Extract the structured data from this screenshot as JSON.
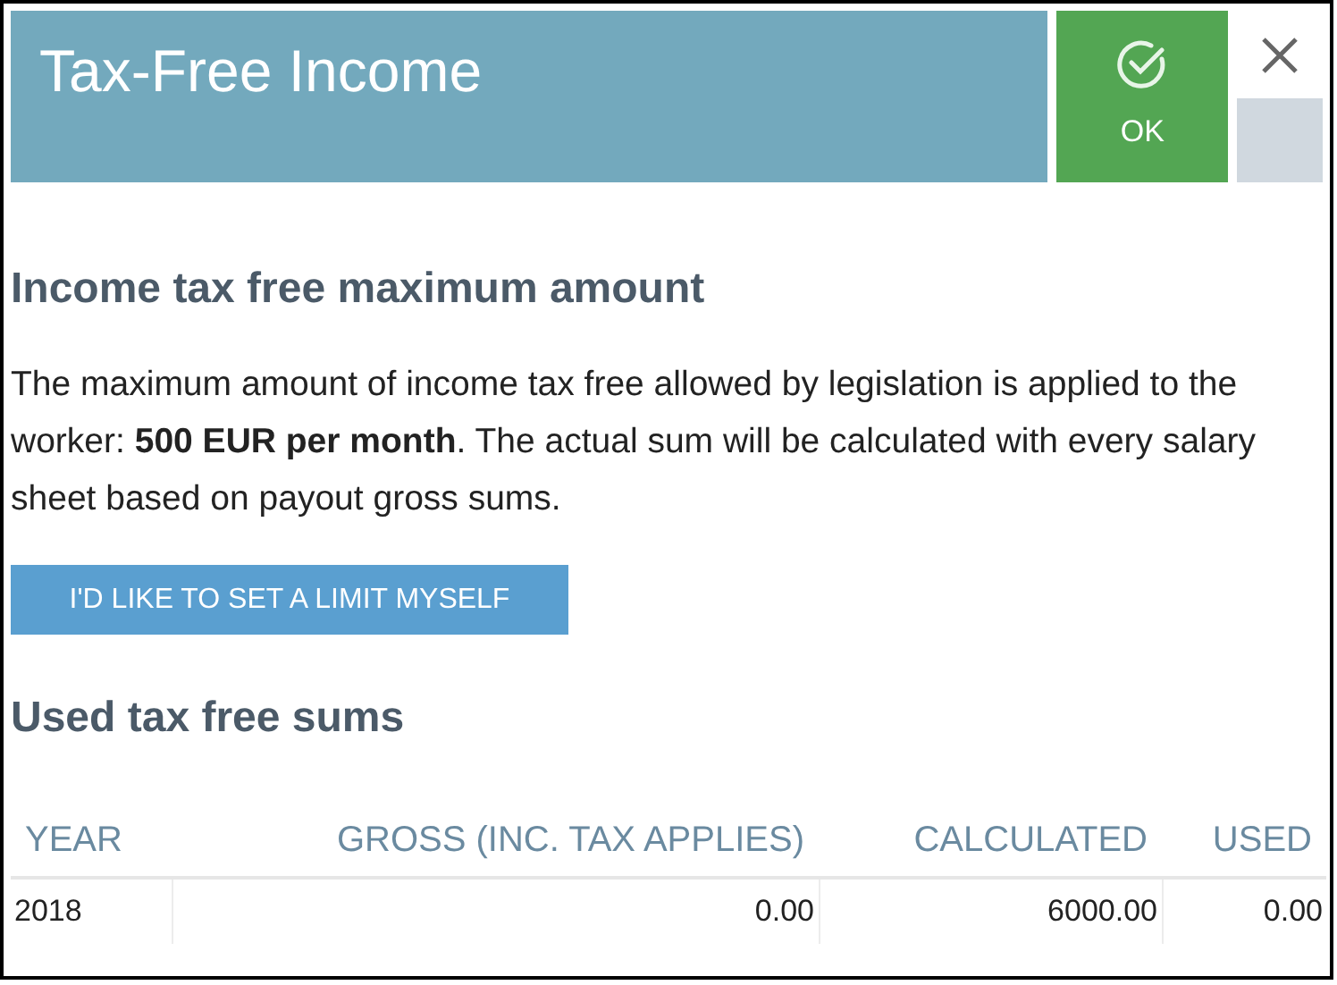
{
  "header": {
    "title": "Tax-Free Income",
    "ok_label": "OK"
  },
  "section1": {
    "heading": "Income tax free maximum amount",
    "text": "The maximum amount of income tax free allowed by legislation is applied to the worker: **500 EUR per month**. The actual sum will be calculated with every salary sheet based on payout gross sums.",
    "button": "I'D LIKE TO SET A LIMIT MYSELF"
  },
  "section2": {
    "heading": "Used tax free sums"
  },
  "table": {
    "columns": [
      "YEAR",
      "GROSS (INC. TAX APPLIES)",
      "CALCULATED",
      "USED"
    ],
    "rows": [
      [
        "2018",
        "0.00",
        "6000.00",
        "0.00"
      ]
    ]
  }
}
